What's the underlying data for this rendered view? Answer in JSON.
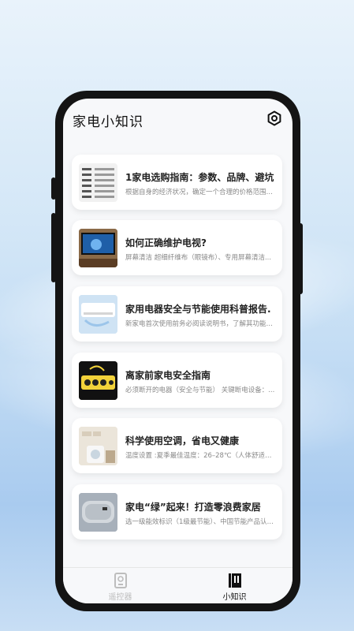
{
  "app": {
    "title": "家电小知识"
  },
  "articles": [
    {
      "title": "1家电选购指南：参数、品牌、避坑",
      "desc": "根据自身的经济状况，确定一个合理的价格范围。..."
    },
    {
      "title": "如何正确维护电视?",
      "desc": "屏幕清洁 超细纤维布（眼镜布）、专用屏幕清洁..."
    },
    {
      "title": "家用电器安全与节能使用科普报告.",
      "desc": "新家电首次使用前务必阅读说明书，了解其功能、..."
    },
    {
      "title": "离家前家电安全指南",
      "desc": "必须断开的电器（安全与节能） 关键断电设备：..."
    },
    {
      "title": "科学使用空调，省电又健康",
      "desc": "温度设置 :夏季最佳温度：26–28℃（人体舒适且..."
    },
    {
      "title": "家电“绿”起来！打造零浪费家居",
      "desc": "选一级能效标识（1级最节能）、中国节能产品认..."
    }
  ],
  "tabs": [
    {
      "label": "遥控器",
      "active": false,
      "icon": "remote-icon"
    },
    {
      "label": "小知识",
      "active": true,
      "icon": "book-icon"
    }
  ],
  "colors": {
    "active_tab": "#111111",
    "inactive_tab": "#bdbdbd",
    "card_bg": "#ffffff",
    "screen_bg": "#f7f8fa"
  }
}
